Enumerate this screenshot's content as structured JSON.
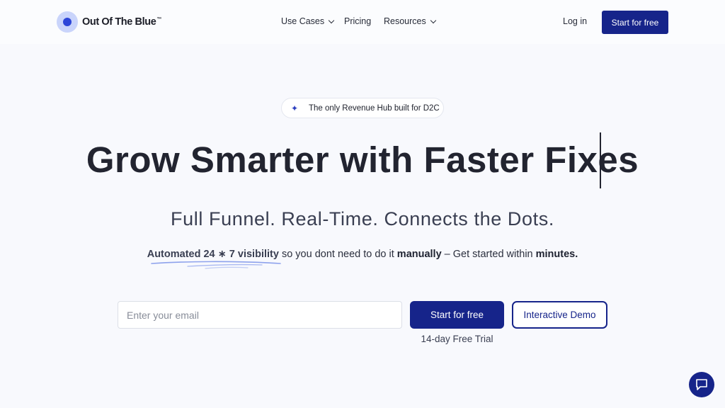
{
  "brand": {
    "name": "Out Of The Blue",
    "tm": "™",
    "accent": "#16248a"
  },
  "nav": {
    "use_cases": "Use Cases",
    "pricing": "Pricing",
    "resources": "Resources",
    "login": "Log in",
    "cta": "Start for free"
  },
  "hero": {
    "badge_icon": "sparkle-icon",
    "badge": "The only Revenue Hub built for D2C",
    "title": "Grow Smarter with Faster Fixes",
    "subtitle": "Full Funnel. Real-Time. Connects the Dots.",
    "tagline": {
      "highlight": "Automated 24 ∗ 7 visibility",
      "middle1": " so you dont need to do it ",
      "bold1": "manually",
      "middle2": " – Get started within ",
      "bold2": "minutes."
    }
  },
  "signup": {
    "email_placeholder": "Enter your email",
    "start": "Start for free",
    "demo": "Interactive Demo",
    "trial": "14-day Free Trial"
  },
  "chat": {
    "icon": "chat-icon"
  }
}
